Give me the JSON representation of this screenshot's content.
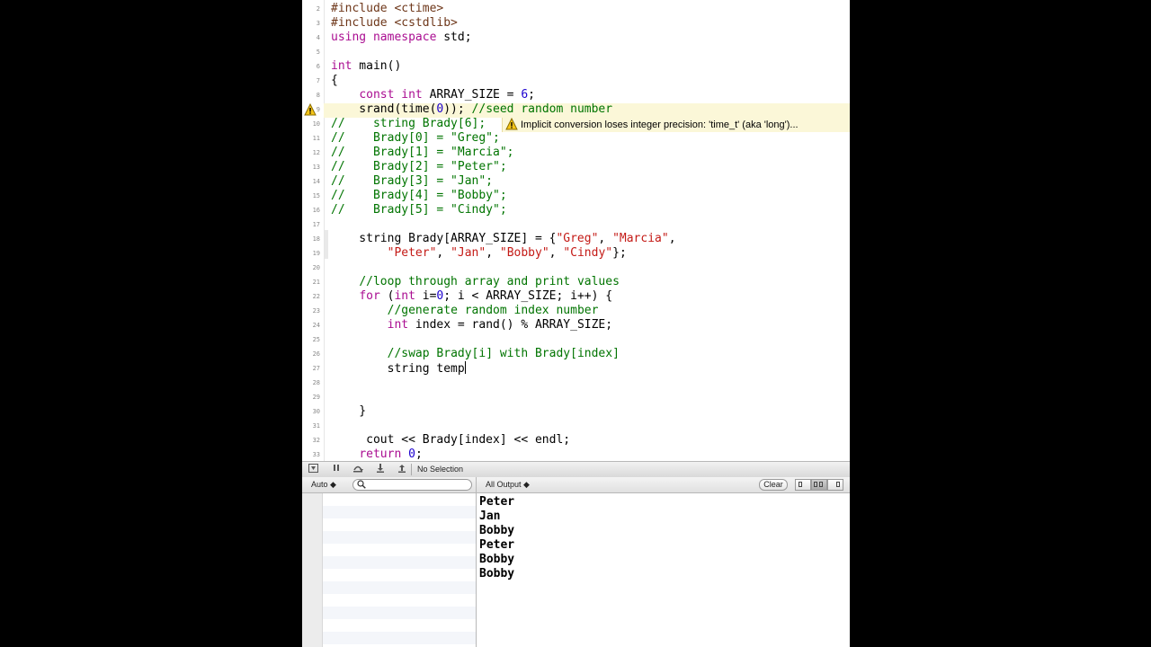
{
  "editor": {
    "lines": [
      {
        "n": "2",
        "html": "<span class='pp'>#include &lt;ctime&gt;</span>"
      },
      {
        "n": "3",
        "html": "<span class='pp'>#include &lt;cstdlib&gt;</span>"
      },
      {
        "n": "4",
        "html": "<span class='kw'>using namespace</span> std;"
      },
      {
        "n": "5",
        "html": ""
      },
      {
        "n": "6",
        "html": "<span class='kw'>int</span> main()"
      },
      {
        "n": "7",
        "html": "{"
      },
      {
        "n": "8",
        "html": "    <span class='kw'>const int</span> ARRAY_SIZE = <span class='num'>6</span>;"
      },
      {
        "n": "9",
        "html": "    srand(time(<span class='num'>0</span>)); <span class='cm'>//seed random number</span>"
      },
      {
        "n": "10",
        "html": "<span class='cm'>//    string Brady[6];</span>"
      },
      {
        "n": "11",
        "html": "<span class='cm'>//    Brady[0] = \"Greg\";</span>"
      },
      {
        "n": "12",
        "html": "<span class='cm'>//    Brady[1] = \"Marcia\";</span>"
      },
      {
        "n": "13",
        "html": "<span class='cm'>//    Brady[2] = \"Peter\";</span>"
      },
      {
        "n": "14",
        "html": "<span class='cm'>//    Brady[3] = \"Jan\";</span>"
      },
      {
        "n": "15",
        "html": "<span class='cm'>//    Brady[4] = \"Bobby\";</span>"
      },
      {
        "n": "16",
        "html": "<span class='cm'>//    Brady[5] = \"Cindy\";</span>"
      },
      {
        "n": "17",
        "html": ""
      },
      {
        "n": "18",
        "html": "    string Brady[ARRAY_SIZE] = {<span class='str'>\"Greg\"</span>, <span class='str'>\"Marcia\"</span>,"
      },
      {
        "n": "19",
        "html": "        <span class='str'>\"Peter\"</span>, <span class='str'>\"Jan\"</span>, <span class='str'>\"Bobby\"</span>, <span class='str'>\"Cindy\"</span>};"
      },
      {
        "n": "20",
        "html": ""
      },
      {
        "n": "21",
        "html": "    <span class='cm'>//loop through array and print values</span>"
      },
      {
        "n": "22",
        "html": "    <span class='kw'>for</span> (<span class='kw'>int</span> i=<span class='num'>0</span>; i &lt; ARRAY_SIZE; i++) {"
      },
      {
        "n": "23",
        "html": "        <span class='cm'>//generate random index number</span>"
      },
      {
        "n": "24",
        "html": "        <span class='kw'>int</span> index = rand() % ARRAY_SIZE;"
      },
      {
        "n": "25",
        "html": ""
      },
      {
        "n": "26",
        "html": "        <span class='cm'>//swap Brady[i] with Brady[index]</span>"
      },
      {
        "n": "27",
        "html": "        string temp<span class='caret'></span>"
      },
      {
        "n": "28",
        "html": ""
      },
      {
        "n": "29",
        "html": ""
      },
      {
        "n": "30",
        "html": "    }"
      },
      {
        "n": "31",
        "html": ""
      },
      {
        "n": "32",
        "html": "     cout &lt;&lt; Brady[index] &lt;&lt; endl;"
      },
      {
        "n": "33",
        "html": "    <span class='kw'>return</span> <span class='num'>0</span>;"
      }
    ],
    "warning_text": "Implicit conversion loses integer precision: 'time_t' (aka 'long')..."
  },
  "debugbar": {
    "selection_label": "No Selection"
  },
  "console": {
    "scope_label": "Auto ◆",
    "output_filter_label": "All Output ◆",
    "clear_label": "Clear",
    "output_lines": [
      "Peter",
      "Jan",
      "Bobby",
      "Peter",
      "Bobby",
      "Bobby"
    ]
  },
  "colors": {
    "warning_bg": "#fbf7d8",
    "keyword": "#aa0d91",
    "string": "#c41a16",
    "number": "#1c00cf",
    "comment": "#007400"
  },
  "icons": [
    "warning-icon",
    "hide-debug-icon",
    "pause-icon",
    "step-over-icon",
    "step-into-icon",
    "step-out-icon",
    "search-icon"
  ]
}
